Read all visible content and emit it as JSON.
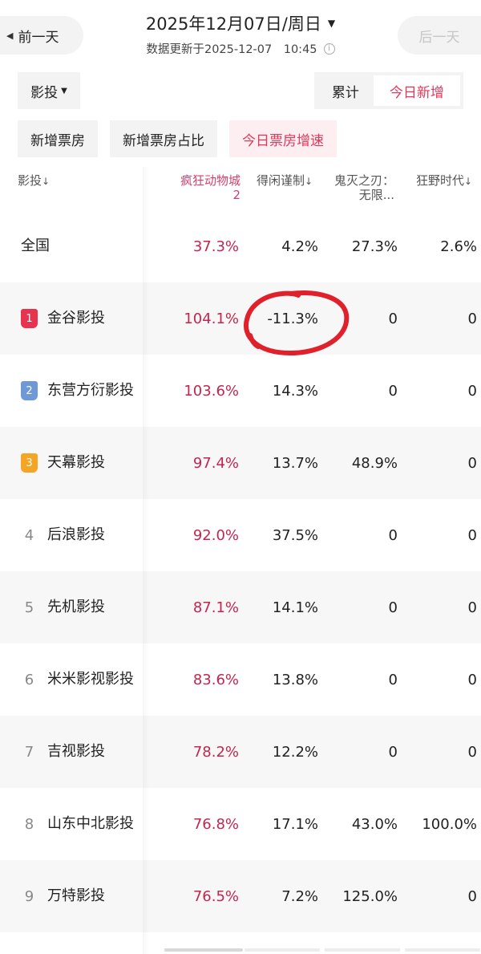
{
  "header": {
    "prev_label": "前一天",
    "next_label": "后一天",
    "date": "2025年12月07日/周日",
    "update_text": "数据更新于2025-12-07　10:45"
  },
  "filters": {
    "dropdown_label": "影投",
    "seg_cumulative": "累计",
    "seg_today": "今日新增",
    "tabs": [
      "新增票房",
      "新增票房占比",
      "今日票房增速"
    ],
    "active_tab_index": 2
  },
  "table": {
    "first_col_header": "影投",
    "columns": [
      "疯狂动物城2",
      "得闲谨制",
      "鬼灭之刃：无限...",
      "狂野时代"
    ],
    "national": {
      "name": "全国",
      "values": [
        "37.3%",
        "4.2%",
        "27.3%",
        "2.6%"
      ]
    },
    "rows": [
      {
        "rank": "1",
        "name": "金谷影投",
        "values": [
          "104.1%",
          "-11.3%",
          "0",
          "0"
        ]
      },
      {
        "rank": "2",
        "name": "东营方衍影投",
        "values": [
          "103.6%",
          "14.3%",
          "0",
          "0"
        ]
      },
      {
        "rank": "3",
        "name": "天幕影投",
        "values": [
          "97.4%",
          "13.7%",
          "48.9%",
          "0"
        ]
      },
      {
        "rank": "4",
        "name": "后浪影投",
        "values": [
          "92.0%",
          "37.5%",
          "0",
          "0"
        ]
      },
      {
        "rank": "5",
        "name": "先机影投",
        "values": [
          "87.1%",
          "14.1%",
          "0",
          "0"
        ]
      },
      {
        "rank": "6",
        "name": "米米影视影投",
        "values": [
          "83.6%",
          "13.8%",
          "0",
          "0"
        ]
      },
      {
        "rank": "7",
        "name": "吉视影投",
        "values": [
          "78.2%",
          "12.2%",
          "0",
          "0"
        ]
      },
      {
        "rank": "8",
        "name": "山东中北影投",
        "values": [
          "76.8%",
          "17.1%",
          "43.0%",
          "100.0%"
        ]
      },
      {
        "rank": "9",
        "name": "万特影投",
        "values": [
          "76.5%",
          "7.2%",
          "125.0%",
          "0"
        ]
      }
    ]
  },
  "colors": {
    "accent": "#e2385a",
    "value_red": "#c2264f",
    "rank1": "#e8334e",
    "rank2": "#6f98d6",
    "rank3": "#f5a524",
    "annotation": "#e0202a"
  },
  "icons": {
    "prev": "triangle-left-icon",
    "date_caret": "triangle-down-icon",
    "info": "info-circle-icon",
    "sort": "sort-arrow-icon"
  }
}
